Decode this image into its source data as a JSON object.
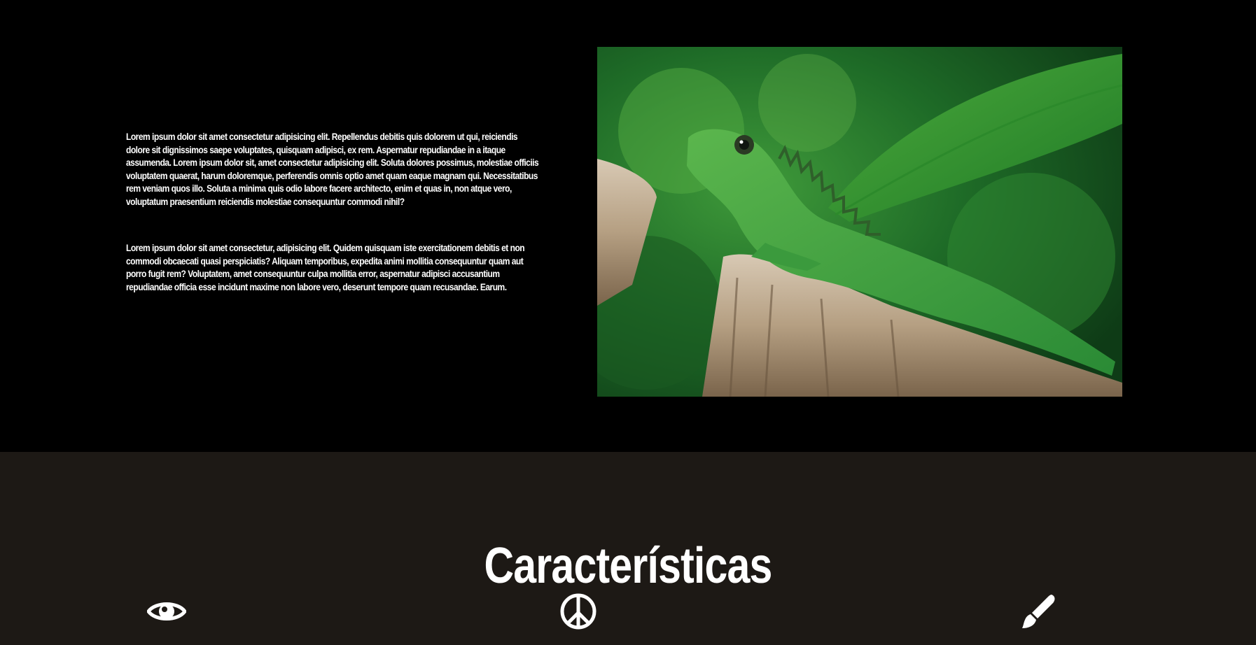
{
  "intro": {
    "paragraphs": [
      "Lorem ipsum dolor sit amet consectetur adipisicing elit. Repellendus debitis quis dolorem ut qui, reiciendis dolore sit dignissimos saepe voluptates, quisquam adipisci, ex rem. Aspernatur repudiandae in a itaque assumenda. Lorem ipsum dolor sit, amet consectetur adipisicing elit. Soluta dolores possimus, molestiae officiis voluptatem quaerat, harum doloremque, perferendis omnis optio amet quam eaque magnam qui. Necessitatibus rem veniam quos illo. Soluta a minima quis odio labore facere architecto, enim et quas in, non atque vero, voluptatum praesentium reiciendis molestiae consequuntur commodi nihil?",
      "Lorem ipsum dolor sit amet consectetur, adipisicing elit. Quidem quisquam iste exercitationem debitis et non commodi obcaecati quasi perspiciatis? Aliquam temporibus, expedita animi mollitia consequuntur quam aut porro fugit rem? Voluptatem, amet consequuntur culpa mollitia error, aspernatur adipisci accusantium repudiandae officia esse incidunt maxime non labore vero, deserunt tempore quam recusandae. Earum."
    ]
  },
  "features": {
    "title": "Características",
    "icons": [
      "eye-icon",
      "peace-icon",
      "paintbrush-icon"
    ]
  },
  "colors": {
    "intro_bg": "#000000",
    "features_bg": "#1d1915",
    "text": "#ffffff"
  }
}
